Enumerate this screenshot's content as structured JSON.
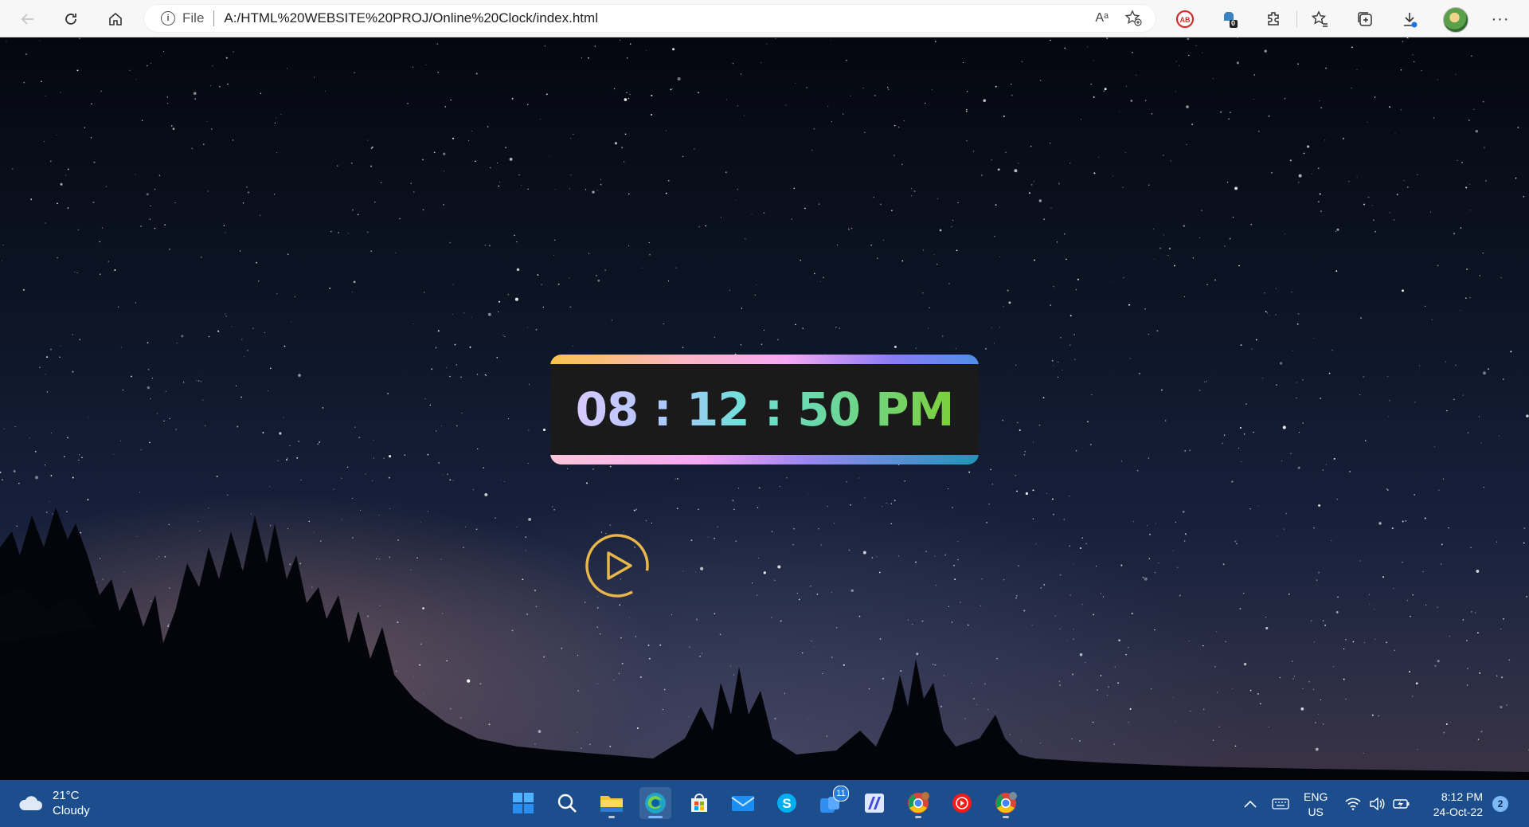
{
  "browser": {
    "address": {
      "scheme_label": "File",
      "url": "A:/HTML%20WEBSITE%20PROJ/Online%20Clock/index.html"
    },
    "read_aloud_label": "Aᵃ",
    "badges": {
      "shield_count": "0"
    }
  },
  "page": {
    "clock": {
      "time_text": "08 : 12 : 50 PM"
    },
    "colors": {
      "play_ring": "#e8b64a",
      "card_top_gradient": [
        "#f9c34c",
        "#fbb7c1",
        "#f7a8f5",
        "#8a7cf3",
        "#4f8fe8"
      ],
      "card_bottom_gradient": [
        "#fbc6d9",
        "#f6a7f3",
        "#9a86f2",
        "#1e97b8"
      ],
      "digit_gradient": [
        "#d8c8ff",
        "#a8c8ff",
        "#6fe0d6",
        "#6ad8a6",
        "#7ccf3a"
      ]
    }
  },
  "taskbar": {
    "weather": {
      "temp": "21°C",
      "condition": "Cloudy"
    },
    "apps": [
      {
        "name": "start-icon"
      },
      {
        "name": "search-icon"
      },
      {
        "name": "file-explorer-icon"
      },
      {
        "name": "edge-icon"
      },
      {
        "name": "store-icon"
      },
      {
        "name": "mail-icon"
      },
      {
        "name": "skype-icon"
      },
      {
        "name": "teams-icon",
        "badge": "11"
      },
      {
        "name": "notepad-icon"
      },
      {
        "name": "chrome-icon"
      },
      {
        "name": "youtube-music-icon"
      },
      {
        "name": "chrome-profile-icon"
      }
    ],
    "tray": {
      "lang_line1": "ENG",
      "lang_line2": "US",
      "time": "8:12 PM",
      "date": "24-Oct-22",
      "notification_count": "2"
    }
  }
}
